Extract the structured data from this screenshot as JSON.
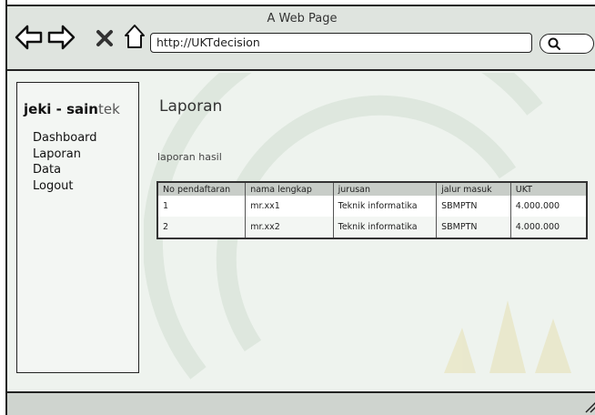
{
  "window": {
    "title": "A Web Page"
  },
  "toolbar": {
    "address_value": "http://UKTdecision",
    "back_icon": "arrow-left-icon",
    "forward_icon": "arrow-right-icon",
    "stop_icon": "x-icon",
    "home_icon": "home-icon",
    "search_icon": "search-icon"
  },
  "sidebar": {
    "brand_main": "jeki - sain",
    "brand_accent": "tek",
    "items": [
      {
        "label": "Dashboard"
      },
      {
        "label": "Laporan"
      },
      {
        "label": "Data"
      },
      {
        "label": "Logout"
      }
    ]
  },
  "main": {
    "heading": "Laporan",
    "subheading": "laporan hasil",
    "table": {
      "columns": [
        "No pendaftaran",
        "nama lengkap",
        "jurusan",
        "jalur masuk",
        "UKT"
      ],
      "rows": [
        [
          "1",
          "mr.xx1",
          "Teknik informatika",
          "SBMPTN",
          "4.000.000"
        ],
        [
          "2",
          "mr.xx2",
          "Teknik informatika",
          "SBMPTN",
          "4.000.000"
        ]
      ]
    }
  },
  "colors": {
    "background": "#eef3ee",
    "chrome": "#dfe4df",
    "table_header": "#c8cdc8",
    "outline": "#222222"
  }
}
